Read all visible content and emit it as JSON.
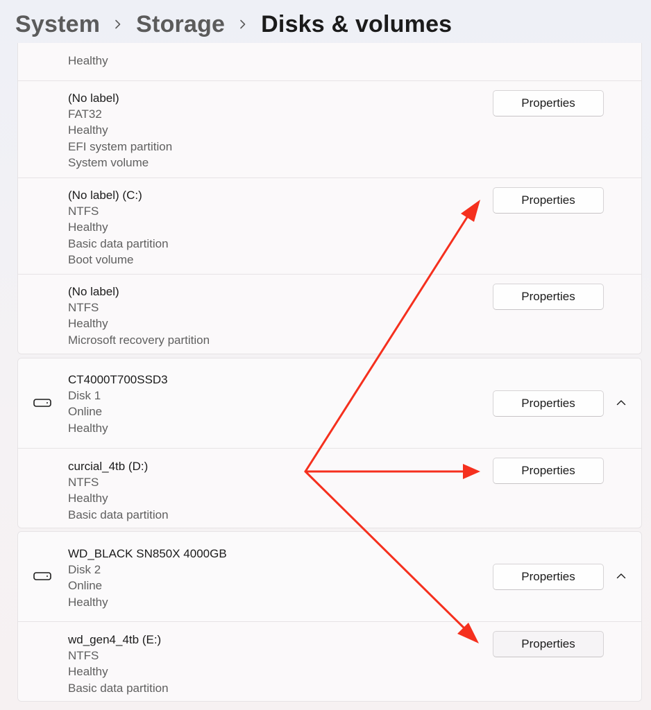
{
  "breadcrumb": {
    "items": [
      "System",
      "Storage",
      "Disks & volumes"
    ]
  },
  "colors": {
    "annotation_arrow": "#f5301e",
    "background": "#f3f1f5",
    "card": "#fbf9fa"
  },
  "button_label": "Properties",
  "card1": {
    "top_partial": {
      "lines": [
        "Healthy"
      ]
    },
    "volumes": [
      {
        "lines": [
          "(No label)",
          "FAT32",
          "Healthy",
          "EFI system partition",
          "System volume"
        ]
      },
      {
        "lines": [
          "(No label) (C:)",
          "NTFS",
          "Healthy",
          "Basic data partition",
          "Boot volume"
        ]
      },
      {
        "lines": [
          "(No label)",
          "NTFS",
          "Healthy",
          "Microsoft recovery partition"
        ]
      }
    ]
  },
  "disk1": {
    "header": {
      "lines": [
        "CT4000T700SSD3",
        "Disk 1",
        "Online",
        "Healthy"
      ],
      "icon": "drive-icon",
      "expand_icon": "chevron-up-icon"
    },
    "volume": {
      "lines": [
        "curcial_4tb (D:)",
        "NTFS",
        "Healthy",
        "Basic data partition"
      ]
    }
  },
  "disk2": {
    "header": {
      "lines": [
        "WD_BLACK SN850X 4000GB",
        "Disk 2",
        "Online",
        "Healthy"
      ],
      "icon": "drive-icon",
      "expand_icon": "chevron-up-icon"
    },
    "volume": {
      "lines": [
        "wd_gen4_4tb (E:)",
        "NTFS",
        "Healthy",
        "Basic data partition"
      ]
    }
  }
}
